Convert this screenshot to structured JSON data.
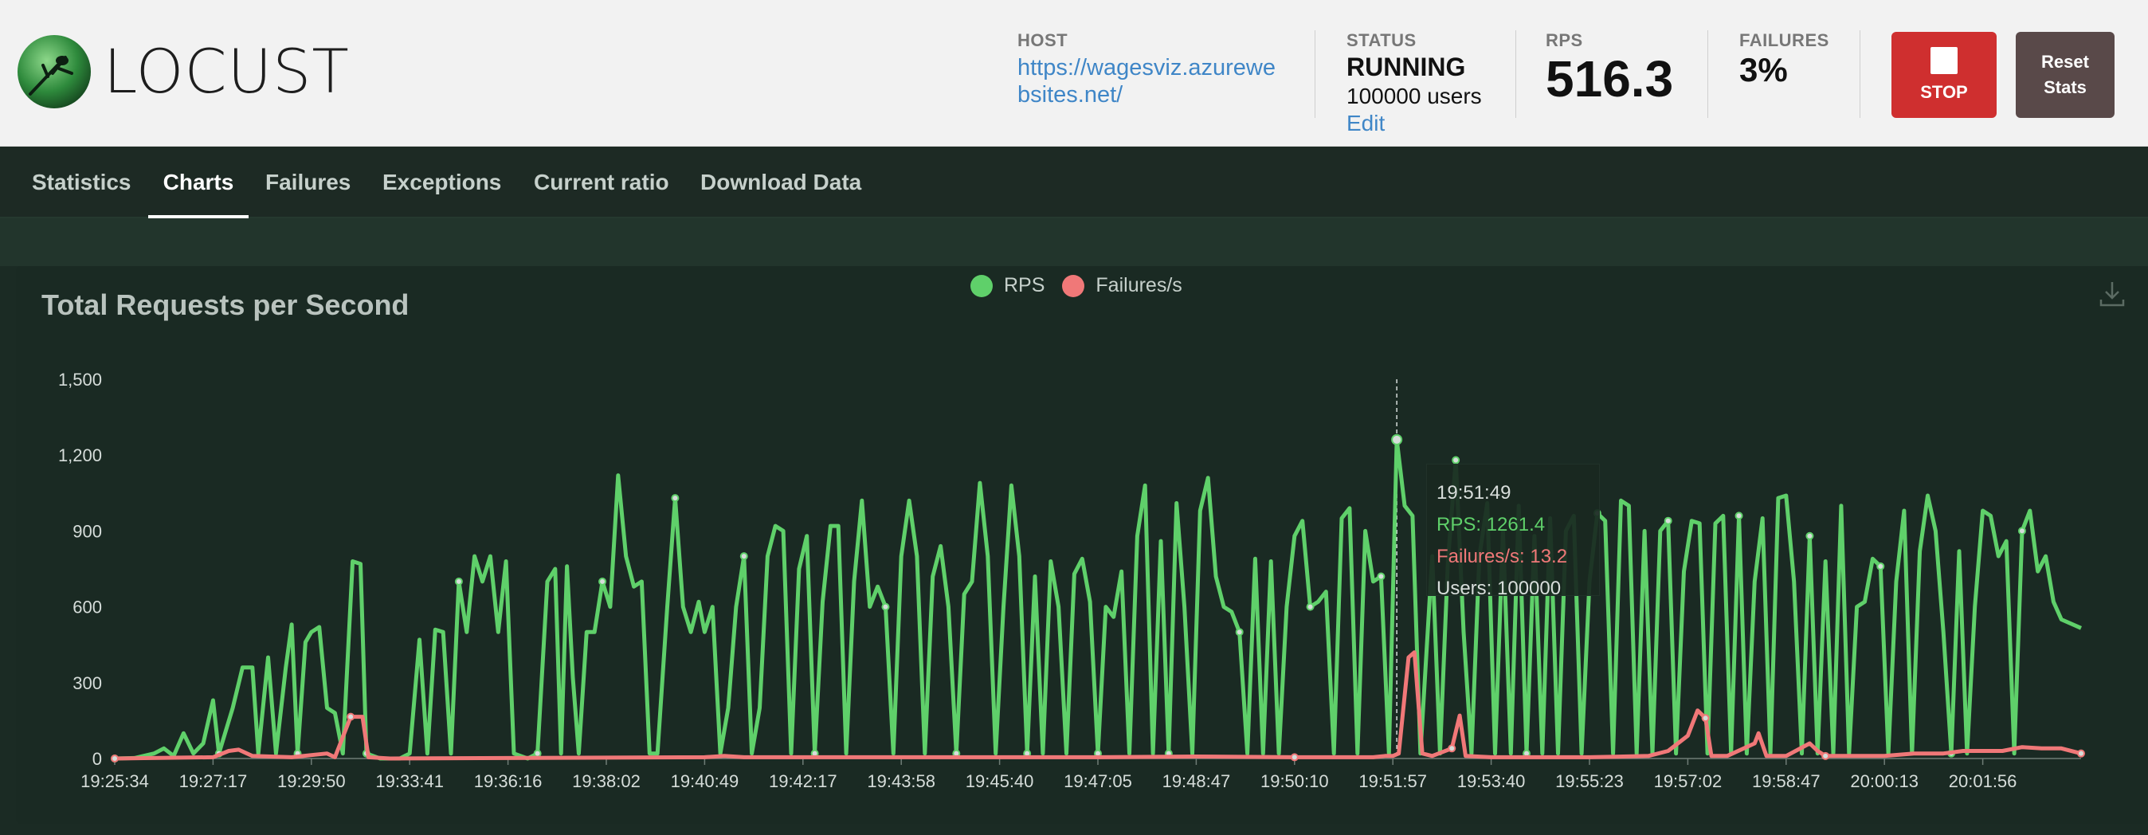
{
  "header": {
    "logo_text": "LOCUST",
    "host": {
      "label": "HOST",
      "value": "https://wagesviz.azurewebsites.net/"
    },
    "status": {
      "label": "STATUS",
      "value": "RUNNING",
      "users": "100000 users",
      "edit": "Edit"
    },
    "rps": {
      "label": "RPS",
      "value": "516.3"
    },
    "failures": {
      "label": "FAILURES",
      "value": "3%"
    },
    "stop_label": "STOP",
    "reset_label": "Reset Stats"
  },
  "tabs": [
    {
      "label": "Statistics",
      "active": false
    },
    {
      "label": "Charts",
      "active": true
    },
    {
      "label": "Failures",
      "active": false
    },
    {
      "label": "Exceptions",
      "active": false
    },
    {
      "label": "Current ratio",
      "active": false
    },
    {
      "label": "Download Data",
      "active": false
    }
  ],
  "colors": {
    "rps": "#5fd06a",
    "failures": "#f07878",
    "accent_stop": "#cf2f2f"
  },
  "icons": {
    "download": "download-icon",
    "stop": "stop-icon",
    "logo": "locust-logo-icon"
  },
  "tooltip": {
    "time": "19:51:49",
    "rps": "RPS: 1261.4",
    "failures": "Failures/s: 13.2",
    "users": "Users: 100000"
  },
  "chart_data": {
    "type": "line",
    "title": "Total Requests per Second",
    "legend": [
      "RPS",
      "Failures/s"
    ],
    "legend_placement": "top-center",
    "ylim": [
      0,
      1500
    ],
    "yticks": [
      "0",
      "300",
      "600",
      "900",
      "1,200",
      "1,500"
    ],
    "ytick_values": [
      0,
      300,
      600,
      900,
      1200,
      1500
    ],
    "xticks": [
      "19:25:34",
      "19:27:17",
      "19:29:50",
      "19:33:41",
      "19:36:16",
      "19:38:02",
      "19:40:49",
      "19:42:17",
      "19:43:58",
      "19:45:40",
      "19:47:05",
      "19:48:47",
      "19:50:10",
      "19:51:57",
      "19:53:40",
      "19:55:23",
      "19:57:02",
      "19:58:47",
      "20:00:13",
      "20:01:56"
    ],
    "x_index_range": [
      0,
      100
    ],
    "x_tick_positions": [
      0,
      5,
      10,
      15,
      20,
      25,
      30,
      35,
      40,
      45,
      50,
      55,
      60,
      65,
      70,
      75,
      80,
      85,
      90,
      95
    ],
    "series": [
      {
        "name": "RPS",
        "points": [
          [
            0,
            0
          ],
          [
            1,
            2
          ],
          [
            2,
            20
          ],
          [
            2.5,
            40
          ],
          [
            3,
            10
          ],
          [
            3.5,
            100
          ],
          [
            4,
            20
          ],
          [
            4.5,
            60
          ],
          [
            5,
            230
          ],
          [
            5.3,
            20
          ],
          [
            6,
            200
          ],
          [
            6.5,
            360
          ],
          [
            7,
            360
          ],
          [
            7.3,
            20
          ],
          [
            7.8,
            400
          ],
          [
            8.2,
            20
          ],
          [
            8.7,
            360
          ],
          [
            9,
            530
          ],
          [
            9.3,
            20
          ],
          [
            9.7,
            460
          ],
          [
            10,
            500
          ],
          [
            10.4,
            520
          ],
          [
            10.8,
            200
          ],
          [
            11.2,
            180
          ],
          [
            11.6,
            20
          ],
          [
            12.1,
            780
          ],
          [
            12.5,
            770
          ],
          [
            12.8,
            20
          ],
          [
            13.5,
            0
          ],
          [
            14.5,
            0
          ],
          [
            15,
            20
          ],
          [
            15.5,
            470
          ],
          [
            15.9,
            20
          ],
          [
            16.3,
            510
          ],
          [
            16.7,
            500
          ],
          [
            17.1,
            20
          ],
          [
            17.5,
            700
          ],
          [
            17.9,
            500
          ],
          [
            18.3,
            800
          ],
          [
            18.7,
            700
          ],
          [
            19.1,
            800
          ],
          [
            19.5,
            500
          ],
          [
            19.9,
            780
          ],
          [
            20.3,
            20
          ],
          [
            21,
            0
          ],
          [
            21.5,
            20
          ],
          [
            22,
            700
          ],
          [
            22.4,
            750
          ],
          [
            22.7,
            20
          ],
          [
            23,
            760
          ],
          [
            23.3,
            320
          ],
          [
            23.6,
            20
          ],
          [
            24,
            500
          ],
          [
            24.4,
            500
          ],
          [
            24.8,
            700
          ],
          [
            25.2,
            600
          ],
          [
            25.6,
            1120
          ],
          [
            26,
            800
          ],
          [
            26.4,
            680
          ],
          [
            26.8,
            700
          ],
          [
            27.2,
            20
          ],
          [
            27.6,
            20
          ],
          [
            28.1,
            600
          ],
          [
            28.5,
            1030
          ],
          [
            28.9,
            600
          ],
          [
            29.3,
            500
          ],
          [
            29.7,
            620
          ],
          [
            30,
            500
          ],
          [
            30.4,
            600
          ],
          [
            30.8,
            20
          ],
          [
            31.2,
            200
          ],
          [
            31.6,
            600
          ],
          [
            32,
            800
          ],
          [
            32.4,
            20
          ],
          [
            32.8,
            200
          ],
          [
            33.2,
            800
          ],
          [
            33.6,
            920
          ],
          [
            34,
            900
          ],
          [
            34.4,
            20
          ],
          [
            34.8,
            750
          ],
          [
            35.2,
            880
          ],
          [
            35.6,
            20
          ],
          [
            36,
            620
          ],
          [
            36.4,
            920
          ],
          [
            36.8,
            920
          ],
          [
            37.2,
            20
          ],
          [
            37.6,
            700
          ],
          [
            38,
            1020
          ],
          [
            38.4,
            600
          ],
          [
            38.8,
            680
          ],
          [
            39.2,
            600
          ],
          [
            39.6,
            20
          ],
          [
            40,
            800
          ],
          [
            40.4,
            1020
          ],
          [
            40.8,
            800
          ],
          [
            41.2,
            20
          ],
          [
            41.6,
            720
          ],
          [
            42,
            840
          ],
          [
            42.4,
            600
          ],
          [
            42.8,
            20
          ],
          [
            43.2,
            650
          ],
          [
            43.6,
            700
          ],
          [
            44,
            1090
          ],
          [
            44.4,
            800
          ],
          [
            44.8,
            20
          ],
          [
            45.2,
            600
          ],
          [
            45.6,
            1080
          ],
          [
            46,
            800
          ],
          [
            46.4,
            20
          ],
          [
            46.8,
            720
          ],
          [
            47.2,
            20
          ],
          [
            47.6,
            780
          ],
          [
            48,
            600
          ],
          [
            48.4,
            20
          ],
          [
            48.8,
            730
          ],
          [
            49.2,
            790
          ],
          [
            49.6,
            620
          ],
          [
            50,
            20
          ],
          [
            50.4,
            600
          ],
          [
            50.8,
            560
          ],
          [
            51.2,
            740
          ],
          [
            51.6,
            20
          ],
          [
            52,
            880
          ],
          [
            52.4,
            1080
          ],
          [
            52.8,
            20
          ],
          [
            53.2,
            860
          ],
          [
            53.6,
            20
          ],
          [
            54,
            1010
          ],
          [
            54.4,
            600
          ],
          [
            54.8,
            20
          ],
          [
            55.2,
            980
          ],
          [
            55.6,
            1110
          ],
          [
            56,
            720
          ],
          [
            56.4,
            600
          ],
          [
            56.8,
            580
          ],
          [
            57.2,
            500
          ],
          [
            57.6,
            20
          ],
          [
            58,
            790
          ],
          [
            58.4,
            20
          ],
          [
            58.8,
            780
          ],
          [
            59.2,
            20
          ],
          [
            59.6,
            600
          ],
          [
            60,
            880
          ],
          [
            60.4,
            940
          ],
          [
            60.8,
            600
          ],
          [
            61.2,
            620
          ],
          [
            61.6,
            660
          ],
          [
            62,
            20
          ],
          [
            62.4,
            950
          ],
          [
            62.8,
            990
          ],
          [
            63.2,
            20
          ],
          [
            63.6,
            900
          ],
          [
            64,
            700
          ],
          [
            64.4,
            720
          ],
          [
            64.8,
            20
          ],
          [
            65.2,
            1261
          ],
          [
            65.6,
            1000
          ],
          [
            66,
            960
          ],
          [
            66.4,
            20
          ],
          [
            67,
            800
          ],
          [
            67.4,
            20
          ],
          [
            67.8,
            780
          ],
          [
            68.2,
            1180
          ],
          [
            68.6,
            500
          ],
          [
            69,
            20
          ],
          [
            69.4,
            800
          ],
          [
            69.8,
            1010
          ],
          [
            70.2,
            20
          ],
          [
            70.6,
            900
          ],
          [
            71,
            20
          ],
          [
            71.4,
            1000
          ],
          [
            71.8,
            20
          ],
          [
            72.2,
            880
          ],
          [
            72.6,
            20
          ],
          [
            73,
            950
          ],
          [
            73.4,
            20
          ],
          [
            73.8,
            900
          ],
          [
            74.2,
            960
          ],
          [
            74.6,
            20
          ],
          [
            75,
            700
          ],
          [
            75.4,
            970
          ],
          [
            75.8,
            940
          ],
          [
            76.2,
            20
          ],
          [
            76.6,
            1020
          ],
          [
            77,
            1000
          ],
          [
            77.4,
            20
          ],
          [
            77.8,
            900
          ],
          [
            78.2,
            20
          ],
          [
            78.6,
            900
          ],
          [
            79,
            940
          ],
          [
            79.4,
            20
          ],
          [
            79.8,
            740
          ],
          [
            80.2,
            940
          ],
          [
            80.6,
            930
          ],
          [
            81,
            20
          ],
          [
            81.4,
            930
          ],
          [
            81.8,
            960
          ],
          [
            82.2,
            20
          ],
          [
            82.6,
            960
          ],
          [
            83,
            20
          ],
          [
            83.4,
            700
          ],
          [
            83.8,
            950
          ],
          [
            84.2,
            20
          ],
          [
            84.6,
            1030
          ],
          [
            85,
            1040
          ],
          [
            85.4,
            700
          ],
          [
            85.8,
            20
          ],
          [
            86.2,
            880
          ],
          [
            86.6,
            20
          ],
          [
            87,
            780
          ],
          [
            87.4,
            20
          ],
          [
            87.8,
            1000
          ],
          [
            88.2,
            20
          ],
          [
            88.6,
            600
          ],
          [
            89,
            620
          ],
          [
            89.4,
            790
          ],
          [
            89.8,
            760
          ],
          [
            90.2,
            20
          ],
          [
            90.6,
            700
          ],
          [
            91,
            980
          ],
          [
            91.4,
            20
          ],
          [
            91.8,
            820
          ],
          [
            92.2,
            1040
          ],
          [
            92.6,
            900
          ],
          [
            93,
            500
          ],
          [
            93.4,
            20
          ],
          [
            93.8,
            820
          ],
          [
            94.2,
            20
          ],
          [
            94.6,
            600
          ],
          [
            95,
            980
          ],
          [
            95.4,
            960
          ],
          [
            95.8,
            800
          ],
          [
            96.2,
            860
          ],
          [
            96.6,
            20
          ],
          [
            97,
            900
          ],
          [
            97.4,
            980
          ],
          [
            97.8,
            740
          ],
          [
            98.2,
            800
          ],
          [
            98.6,
            620
          ],
          [
            99,
            550
          ],
          [
            100,
            516
          ]
        ]
      },
      {
        "name": "Failures/s",
        "points": [
          [
            0,
            0
          ],
          [
            5,
            5
          ],
          [
            5.8,
            30
          ],
          [
            6.3,
            35
          ],
          [
            7,
            10
          ],
          [
            9,
            5
          ],
          [
            10.2,
            15
          ],
          [
            10.8,
            20
          ],
          [
            11.2,
            5
          ],
          [
            12,
            165
          ],
          [
            12.6,
            165
          ],
          [
            12.9,
            5
          ],
          [
            14,
            0
          ],
          [
            30,
            5
          ],
          [
            31,
            10
          ],
          [
            32,
            5
          ],
          [
            50,
            5
          ],
          [
            55,
            8
          ],
          [
            60,
            5
          ],
          [
            64,
            5
          ],
          [
            64.6,
            10
          ],
          [
            65,
            10
          ],
          [
            65.3,
            20
          ],
          [
            65.8,
            400
          ],
          [
            66.1,
            420
          ],
          [
            66.5,
            20
          ],
          [
            67,
            10
          ],
          [
            68,
            40
          ],
          [
            68.4,
            170
          ],
          [
            68.7,
            10
          ],
          [
            70,
            5
          ],
          [
            75,
            5
          ],
          [
            78,
            10
          ],
          [
            79,
            30
          ],
          [
            80,
            90
          ],
          [
            80.5,
            190
          ],
          [
            80.9,
            160
          ],
          [
            81.2,
            10
          ],
          [
            82,
            10
          ],
          [
            83.4,
            60
          ],
          [
            83.6,
            100
          ],
          [
            84,
            10
          ],
          [
            85,
            10
          ],
          [
            86.2,
            60
          ],
          [
            86.6,
            30
          ],
          [
            87,
            10
          ],
          [
            90,
            10
          ],
          [
            91.5,
            20
          ],
          [
            93,
            20
          ],
          [
            94,
            30
          ],
          [
            96,
            30
          ],
          [
            97,
            45
          ],
          [
            98,
            40
          ],
          [
            99,
            40
          ],
          [
            100,
            20
          ]
        ]
      }
    ],
    "hover_index": 65.2
  }
}
